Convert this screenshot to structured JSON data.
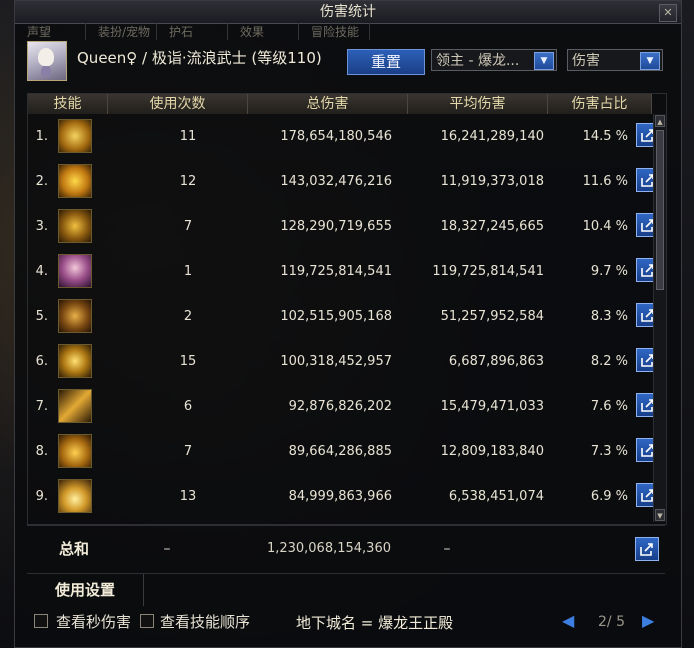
{
  "window": {
    "title": "伤害统计",
    "close_label": "✕"
  },
  "background_tabs": [
    "声望",
    "装扮/宠物",
    "护石",
    "效果",
    "冒险技能"
  ],
  "header": {
    "character_name": "Queen♀ / 极诣·流浪武士 (等级110)",
    "reset_label": "重置",
    "target_select": "领主 - 爆龙...",
    "metric_select": "伤害"
  },
  "columns": [
    "技能",
    "使用次数",
    "总伤害",
    "平均伤害",
    "伤害占比"
  ],
  "rows": [
    {
      "index": "1.",
      "icon": "crescent-slash-icon",
      "uses": "11",
      "total": "178,654,180,546",
      "average": "16,241,289,140",
      "percent": "14.5 %"
    },
    {
      "index": "2.",
      "icon": "flame-swirl-icon",
      "uses": "12",
      "total": "143,032,476,216",
      "average": "11,919,373,018",
      "percent": "11.6 %"
    },
    {
      "index": "3.",
      "icon": "sword-burst-icon",
      "uses": "7",
      "total": "128,290,719,655",
      "average": "18,327,245,665",
      "percent": "10.4 %"
    },
    {
      "index": "4.",
      "icon": "samurai-portrait-icon",
      "uses": "1",
      "total": "119,725,814,541",
      "average": "119,725,814,541",
      "percent": "9.7 %"
    },
    {
      "index": "5.",
      "icon": "spiral-blade-icon",
      "uses": "2",
      "total": "102,515,905,168",
      "average": "51,257,952,584",
      "percent": "8.3 %"
    },
    {
      "index": "6.",
      "icon": "star-flower-icon",
      "uses": "15",
      "total": "100,318,452,957",
      "average": "6,687,896,863",
      "percent": "8.2 %"
    },
    {
      "index": "7.",
      "icon": "lightning-strike-icon",
      "uses": "6",
      "total": "92,876,826,202",
      "average": "15,479,471,033",
      "percent": "7.6 %"
    },
    {
      "index": "8.",
      "icon": "golden-palm-icon",
      "uses": "7",
      "total": "89,664,286,885",
      "average": "12,809,183,840",
      "percent": "7.3 %"
    },
    {
      "index": "9.",
      "icon": "explosion-burst-icon",
      "uses": "13",
      "total": "84,999,863,966",
      "average": "6,538,451,074",
      "percent": "6.9 %"
    }
  ],
  "totals": {
    "label": "总和",
    "uses": "–",
    "total": "1,230,068,154,360",
    "average": "–"
  },
  "settings": {
    "tab_label": "使用设置"
  },
  "footer": {
    "show_dps_label": "查看秒伤害",
    "show_skill_order_label": "查看技能顺序",
    "dungeon_label": "地下城名 = 爆龙王正殿",
    "pager_text": "2/ 5"
  },
  "colors": {
    "accent_blue": "#2f67c4",
    "header_gold": "#e3d6a8",
    "icon_gold": "#e0b030"
  }
}
